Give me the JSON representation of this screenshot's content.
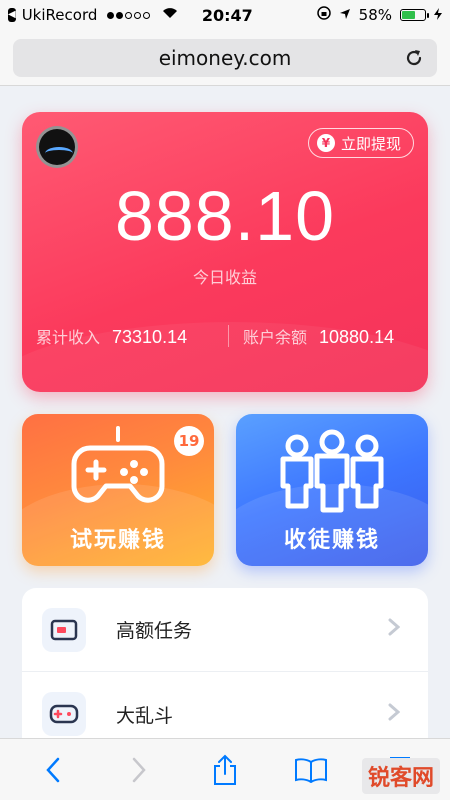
{
  "status_bar": {
    "carrier": "UkiRecord",
    "time": "20:47",
    "battery": "58%",
    "battery_level": 0.58
  },
  "browser": {
    "url": "eimoney.com"
  },
  "earnings_card": {
    "withdraw_label": "立即提现",
    "withdraw_icon": "yen-icon",
    "amount": "888.10",
    "amount_label": "今日收益",
    "total_income_label": "累计收入",
    "total_income_value": "73310.14",
    "balance_label": "账户余额",
    "balance_value": "10880.14"
  },
  "tiles": {
    "play": {
      "label": "试玩赚钱",
      "badge": "19",
      "icon": "gamepad-icon"
    },
    "recruit": {
      "label": "收徒赚钱",
      "icon": "people-icon"
    }
  },
  "list": [
    {
      "label": "高额任务",
      "icon": "card-icon"
    },
    {
      "label": "大乱斗",
      "icon": "gamepad-icon"
    }
  ],
  "watermark": "锐客网",
  "colors": {
    "card_red": "#f4335a",
    "tile_orange": "#ff8a3d",
    "tile_blue": "#3d76ff",
    "ios_blue": "#007aff"
  }
}
